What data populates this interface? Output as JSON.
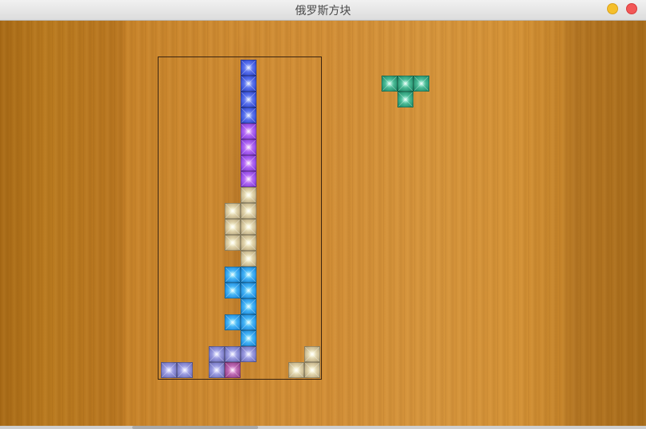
{
  "window": {
    "title": "俄罗斯方块"
  },
  "colors": {
    "blue": "#4f67e8",
    "violet": "#a55cf0",
    "tan": "#d8c9a0",
    "sky": "#3aa8f2",
    "lavender": "#8e8fd8",
    "magenta": "#b25ea8",
    "teal": "#3fae8a"
  },
  "board": {
    "columns": 10,
    "rows": 20,
    "cells": [
      {
        "col": 5,
        "row": 0,
        "color": "blue"
      },
      {
        "col": 5,
        "row": 1,
        "color": "blue"
      },
      {
        "col": 5,
        "row": 2,
        "color": "blue"
      },
      {
        "col": 5,
        "row": 3,
        "color": "blue"
      },
      {
        "col": 5,
        "row": 4,
        "color": "violet"
      },
      {
        "col": 5,
        "row": 5,
        "color": "violet"
      },
      {
        "col": 5,
        "row": 6,
        "color": "violet"
      },
      {
        "col": 5,
        "row": 7,
        "color": "violet"
      },
      {
        "col": 5,
        "row": 8,
        "color": "tan"
      },
      {
        "col": 4,
        "row": 9,
        "color": "tan"
      },
      {
        "col": 5,
        "row": 9,
        "color": "tan"
      },
      {
        "col": 4,
        "row": 10,
        "color": "tan"
      },
      {
        "col": 5,
        "row": 10,
        "color": "tan"
      },
      {
        "col": 4,
        "row": 11,
        "color": "tan"
      },
      {
        "col": 5,
        "row": 11,
        "color": "tan"
      },
      {
        "col": 5,
        "row": 12,
        "color": "tan"
      },
      {
        "col": 4,
        "row": 13,
        "color": "sky"
      },
      {
        "col": 5,
        "row": 13,
        "color": "sky"
      },
      {
        "col": 4,
        "row": 14,
        "color": "sky"
      },
      {
        "col": 5,
        "row": 14,
        "color": "sky"
      },
      {
        "col": 5,
        "row": 15,
        "color": "sky"
      },
      {
        "col": 4,
        "row": 16,
        "color": "sky"
      },
      {
        "col": 5,
        "row": 16,
        "color": "sky"
      },
      {
        "col": 5,
        "row": 17,
        "color": "sky"
      },
      {
        "col": 3,
        "row": 18,
        "color": "lavender"
      },
      {
        "col": 4,
        "row": 18,
        "color": "lavender"
      },
      {
        "col": 5,
        "row": 18,
        "color": "lavender"
      },
      {
        "col": 9,
        "row": 18,
        "color": "tan"
      },
      {
        "col": 0,
        "row": 19,
        "color": "lavender"
      },
      {
        "col": 1,
        "row": 19,
        "color": "lavender"
      },
      {
        "col": 3,
        "row": 19,
        "color": "lavender"
      },
      {
        "col": 4,
        "row": 19,
        "color": "magenta"
      },
      {
        "col": 8,
        "row": 19,
        "color": "tan"
      },
      {
        "col": 9,
        "row": 19,
        "color": "tan"
      }
    ]
  },
  "next_piece": {
    "shape": "T",
    "color": "teal",
    "cells": [
      {
        "col": 0,
        "row": 0
      },
      {
        "col": 1,
        "row": 0
      },
      {
        "col": 2,
        "row": 0
      },
      {
        "col": 1,
        "row": 1
      }
    ]
  }
}
